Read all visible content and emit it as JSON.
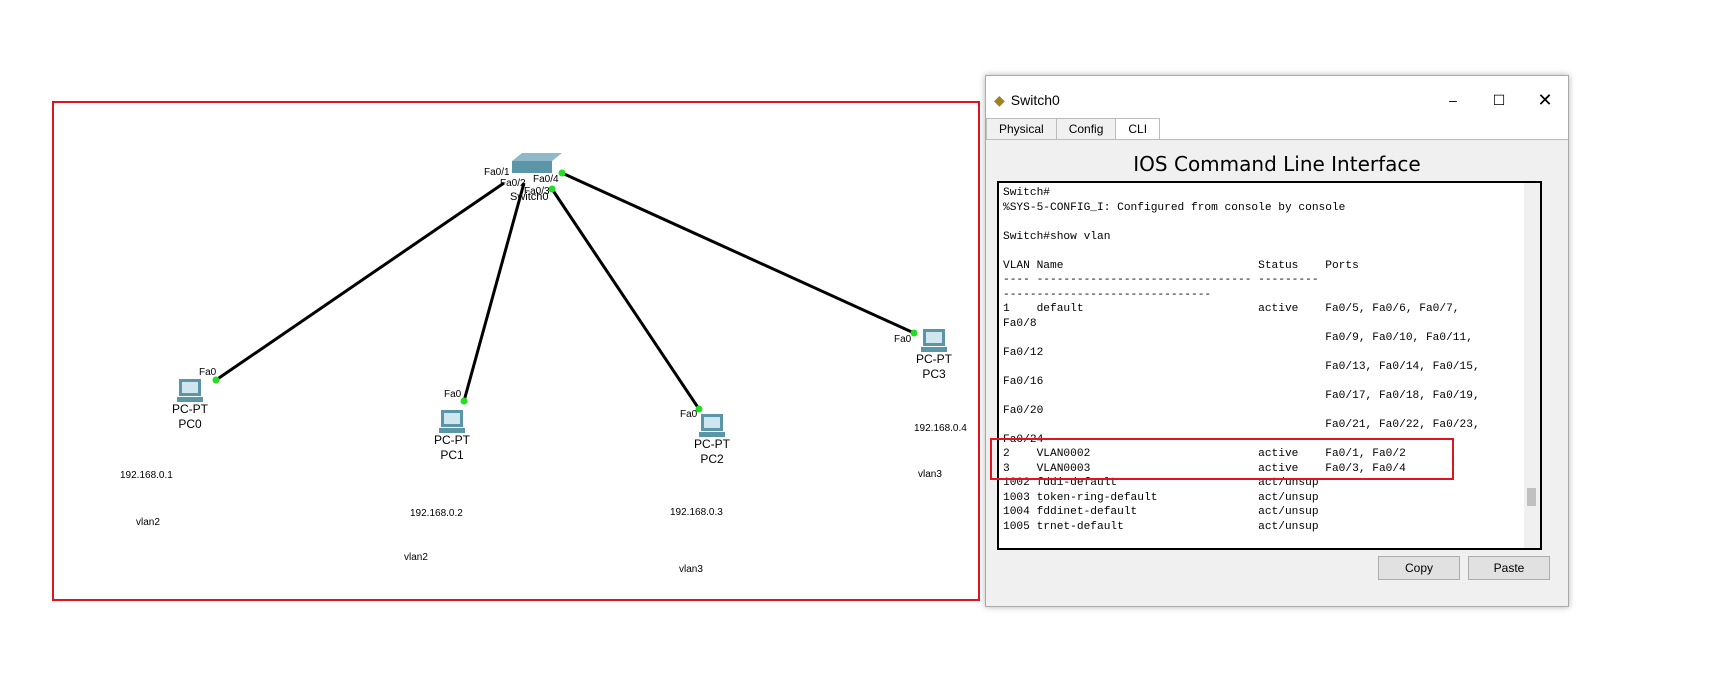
{
  "topology": {
    "switch": {
      "name": "Switch0",
      "ports": [
        "Fa0/1",
        "Fa0/2",
        "Fa0/3",
        "Fa0/4"
      ]
    },
    "pcs": [
      {
        "type": "PC-PT",
        "name": "PC0",
        "port": "Fa0",
        "ip": "192.168.0.1",
        "vlan": "vlan2"
      },
      {
        "type": "PC-PT",
        "name": "PC1",
        "port": "Fa0",
        "ip": "192.168.0.2",
        "vlan": "vlan2"
      },
      {
        "type": "PC-PT",
        "name": "PC2",
        "port": "Fa0",
        "ip": "192.168.0.3",
        "vlan": "vlan3"
      },
      {
        "type": "PC-PT",
        "name": "PC3",
        "port": "Fa0",
        "ip": "192.168.0.4",
        "vlan": "vlan3"
      }
    ],
    "link_color": "#000000",
    "port_up_color": "#22dd22",
    "highlight_color": "#e0141e"
  },
  "window": {
    "title": "Switch0",
    "tabs": [
      "Physical",
      "Config",
      "CLI"
    ],
    "active_tab": "CLI",
    "heading": "IOS Command Line Interface",
    "terminal": "Switch#\n%SYS-5-CONFIG_I: Configured from console by console\n\nSwitch#show vlan\n\nVLAN Name                             Status    Ports\n---- -------------------------------- ---------\n-------------------------------\n1    default                          active    Fa0/5, Fa0/6, Fa0/7,\nFa0/8\n                                                Fa0/9, Fa0/10, Fa0/11,\nFa0/12\n                                                Fa0/13, Fa0/14, Fa0/15,\nFa0/16\n                                                Fa0/17, Fa0/18, Fa0/19,\nFa0/20\n                                                Fa0/21, Fa0/22, Fa0/23,\nFa0/24\n2    VLAN0002                         active    Fa0/1, Fa0/2\n3    VLAN0003                         active    Fa0/3, Fa0/4\n1002 fddi-default                     act/unsup\n1003 token-ring-default               act/unsup\n1004 fddinet-default                  act/unsup\n1005 trnet-default                    act/unsup",
    "copy": "Copy",
    "paste": "Paste"
  }
}
